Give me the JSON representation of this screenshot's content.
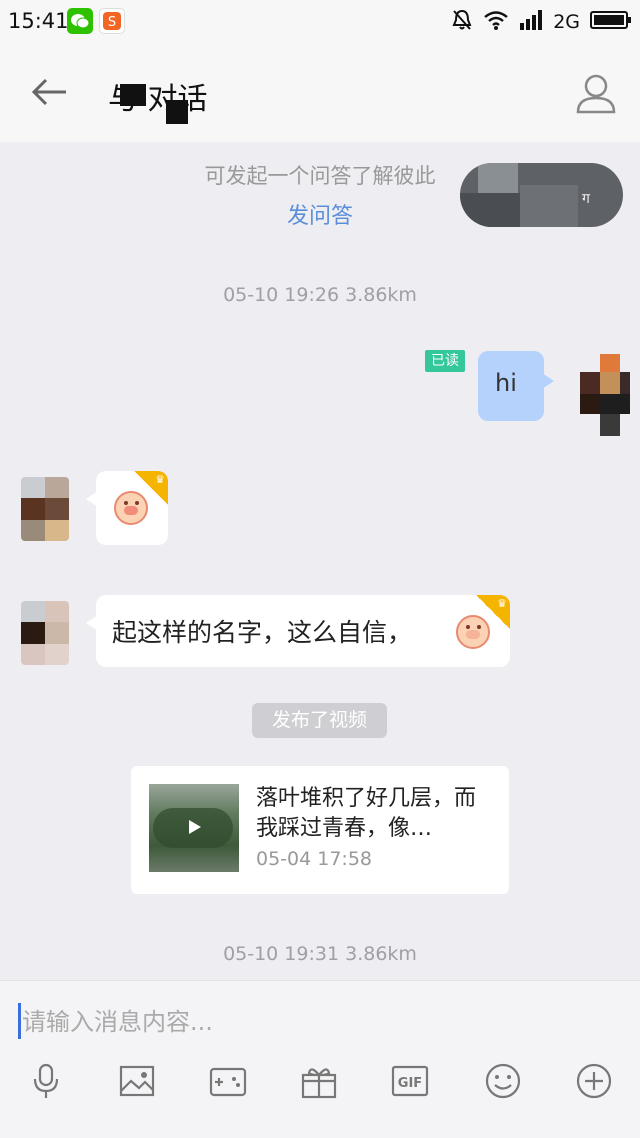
{
  "status_bar": {
    "time": "15:41",
    "network": "2G",
    "icons": [
      "wechat-icon",
      "sogou-icon",
      "bell-muted-icon",
      "wifi-icon",
      "signal-icon",
      "battery-icon"
    ]
  },
  "header": {
    "title": "与   对话",
    "back_icon": "back-arrow-icon",
    "profile_icon": "profile-icon"
  },
  "chat": {
    "hint": "可发起一个问答了解彼此",
    "ask_link": "发问答",
    "floating_mark": "ग",
    "timestamps": [
      "05-10 19:26  3.86km",
      "05-10 19:31  3.86km"
    ],
    "messages": [
      {
        "direction": "out",
        "text": "hi",
        "read_label": "已读"
      },
      {
        "direction": "in",
        "type": "emoji",
        "emoji": "pig-smile"
      },
      {
        "direction": "in",
        "type": "text",
        "text": "起这样的名字，这么自信，",
        "emoji": "pig-cover-mouth"
      }
    ],
    "event": "发布了视频",
    "video": {
      "title": "落叶堆积了好几层，而我踩过青春，像…",
      "date": "05-04 17:58"
    }
  },
  "input": {
    "placeholder": "请输入消息内容..."
  },
  "toolbar": [
    "microphone-icon",
    "image-icon",
    "game-icon",
    "gift-icon",
    "gif-icon",
    "emoji-icon",
    "plus-icon"
  ],
  "colors": {
    "accent_link": "#5a8fd8",
    "read_badge": "#34c79b",
    "outgoing_bubble": "#b4d2fb",
    "vip_corner": "#f5b400",
    "background": "#ededf2"
  }
}
